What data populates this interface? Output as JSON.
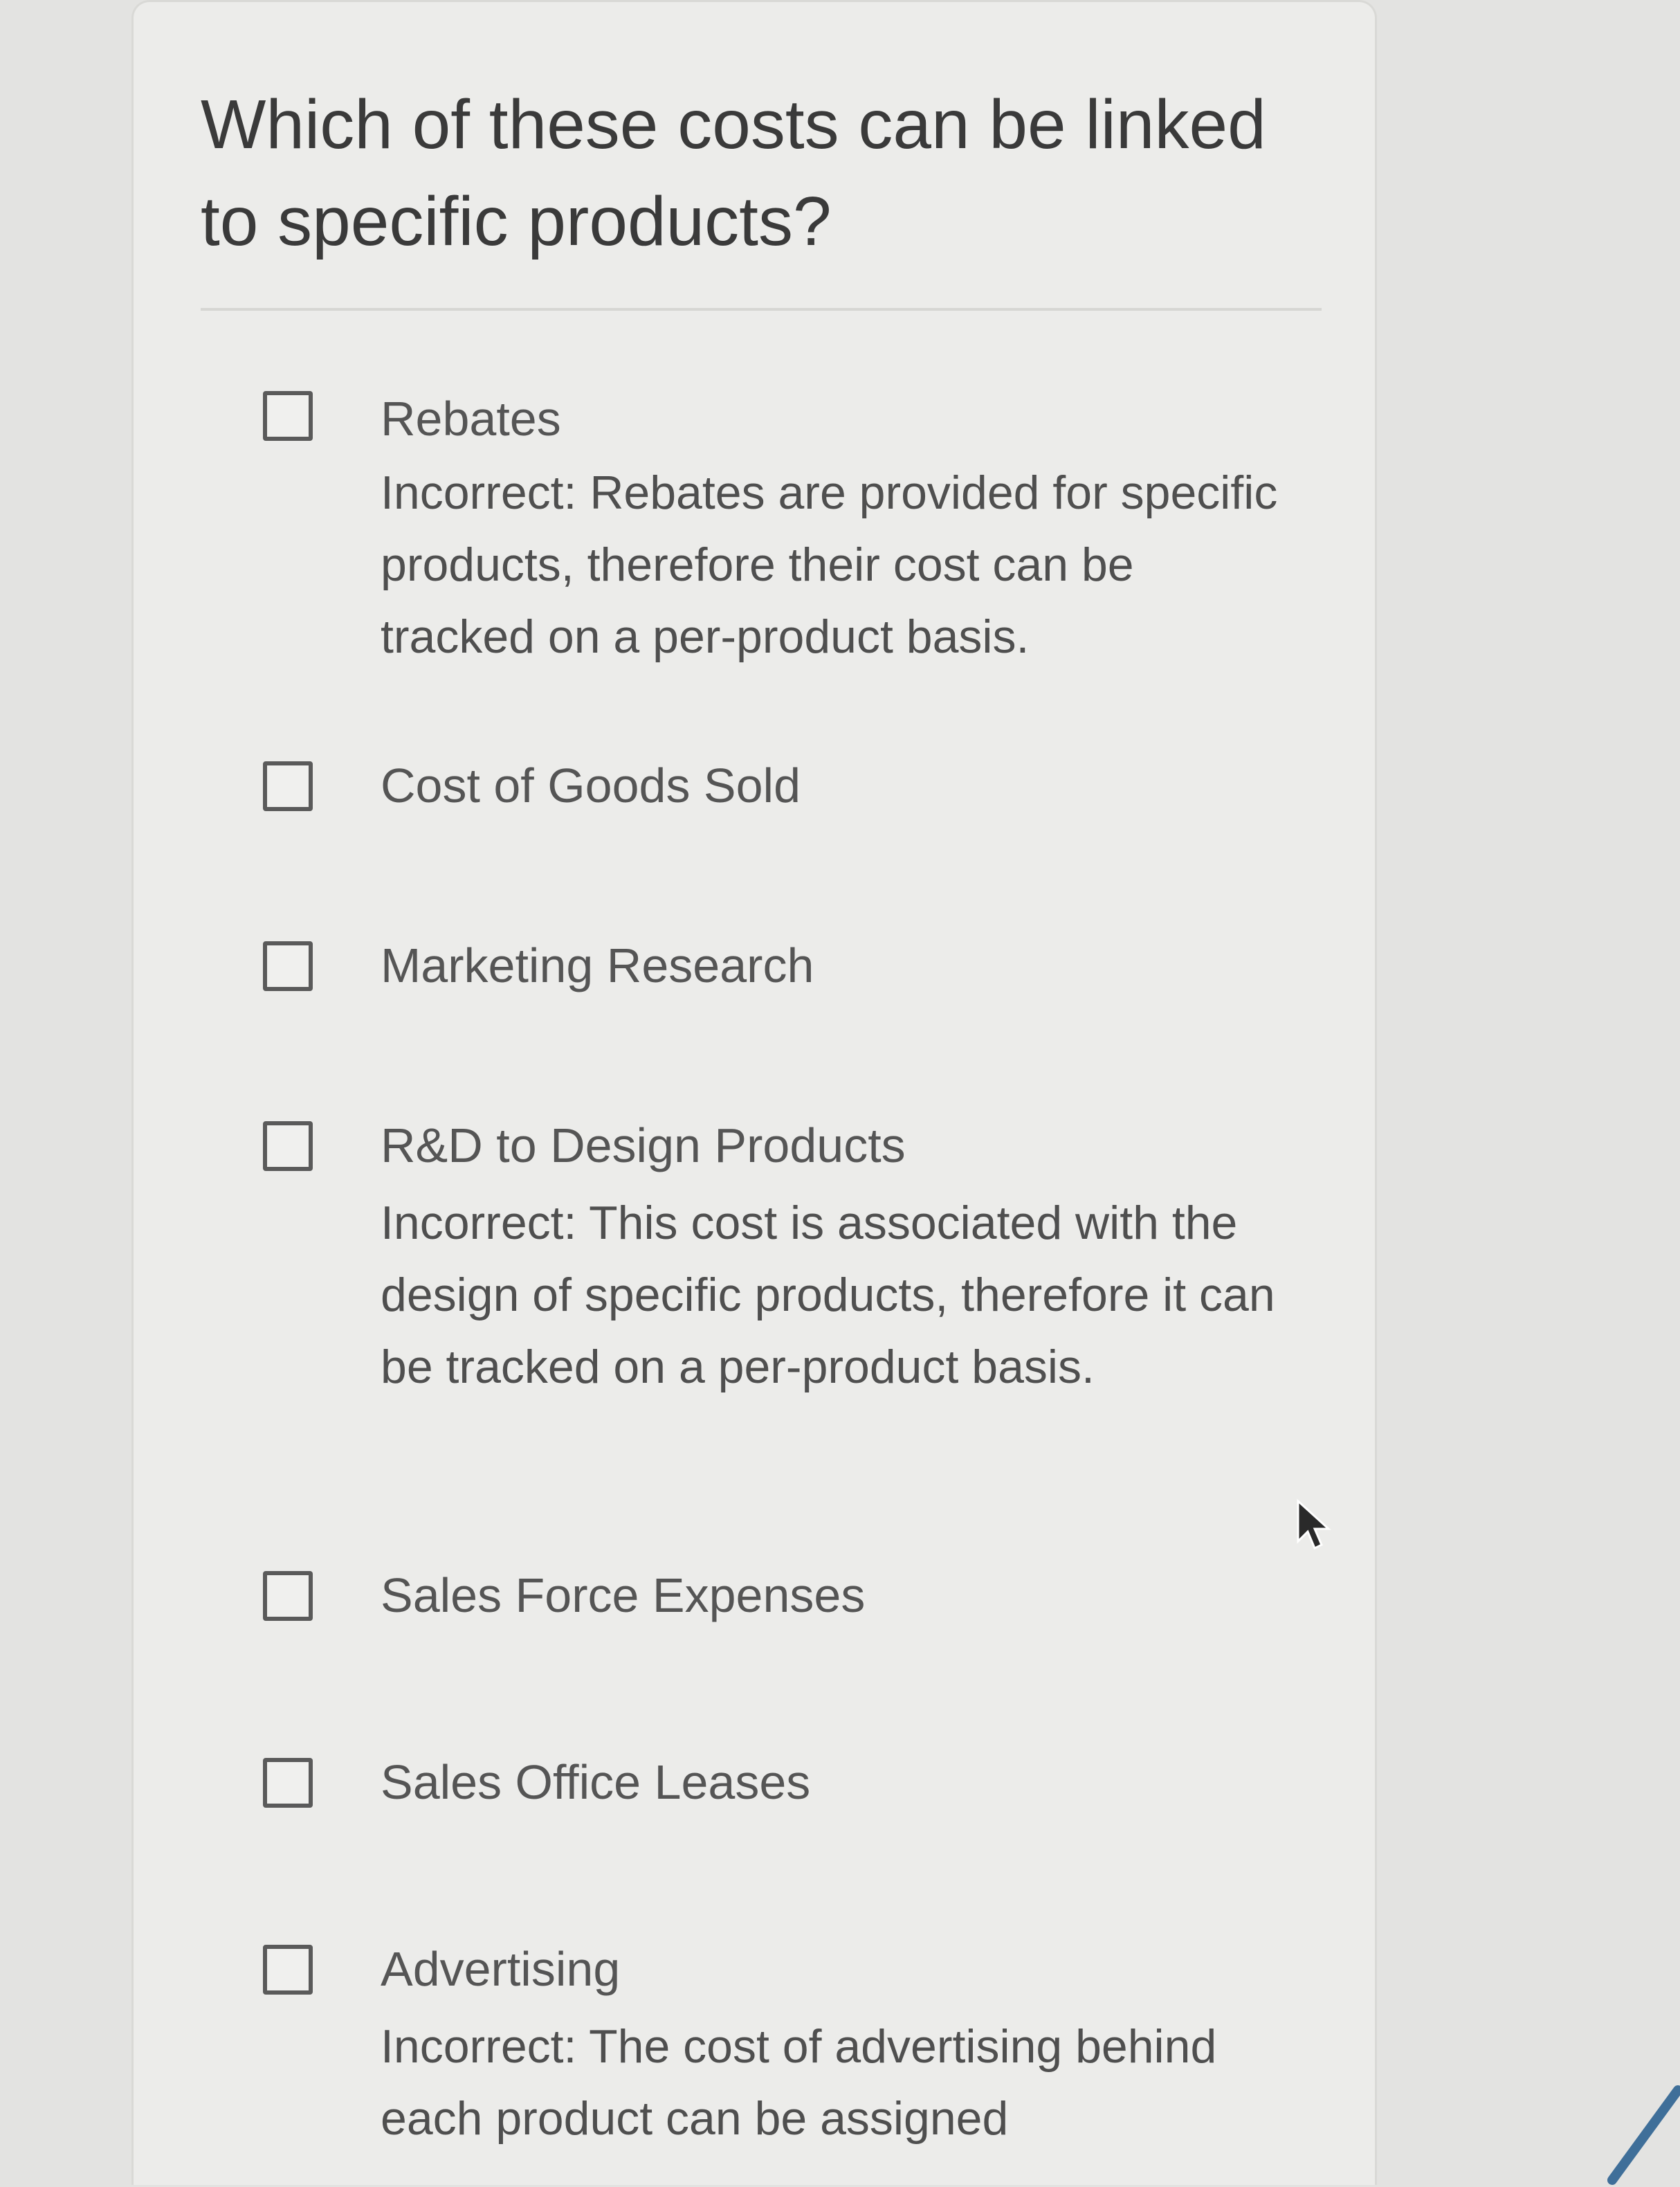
{
  "question": {
    "title": "Which of these costs can be linked to specific products?"
  },
  "options": [
    {
      "label": "Rebates",
      "feedback": "Incorrect: Rebates are provided for specific products, therefore their cost can be tracked on a per-product basis."
    },
    {
      "label": "Cost of Goods Sold",
      "feedback": ""
    },
    {
      "label": "Marketing Research",
      "feedback": ""
    },
    {
      "label": "R&D to Design Products",
      "feedback": "Incorrect: This cost is associated with the design of specific products, therefore it can be tracked on a per-product basis."
    },
    {
      "label": "Sales Force Expenses",
      "feedback": ""
    },
    {
      "label": "Sales Office Leases",
      "feedback": ""
    },
    {
      "label": "Advertising",
      "feedback": "Incorrect: The cost of advertising behind each product can be assigned"
    }
  ],
  "colors": {
    "background": "#e3e3e1",
    "card": "#ececea",
    "text": "#3a3a3a",
    "checkbox_border": "#5a5a5a"
  },
  "icons": {
    "cursor": "mouse-pointer-icon",
    "checkbox": "checkbox-unchecked-icon"
  }
}
